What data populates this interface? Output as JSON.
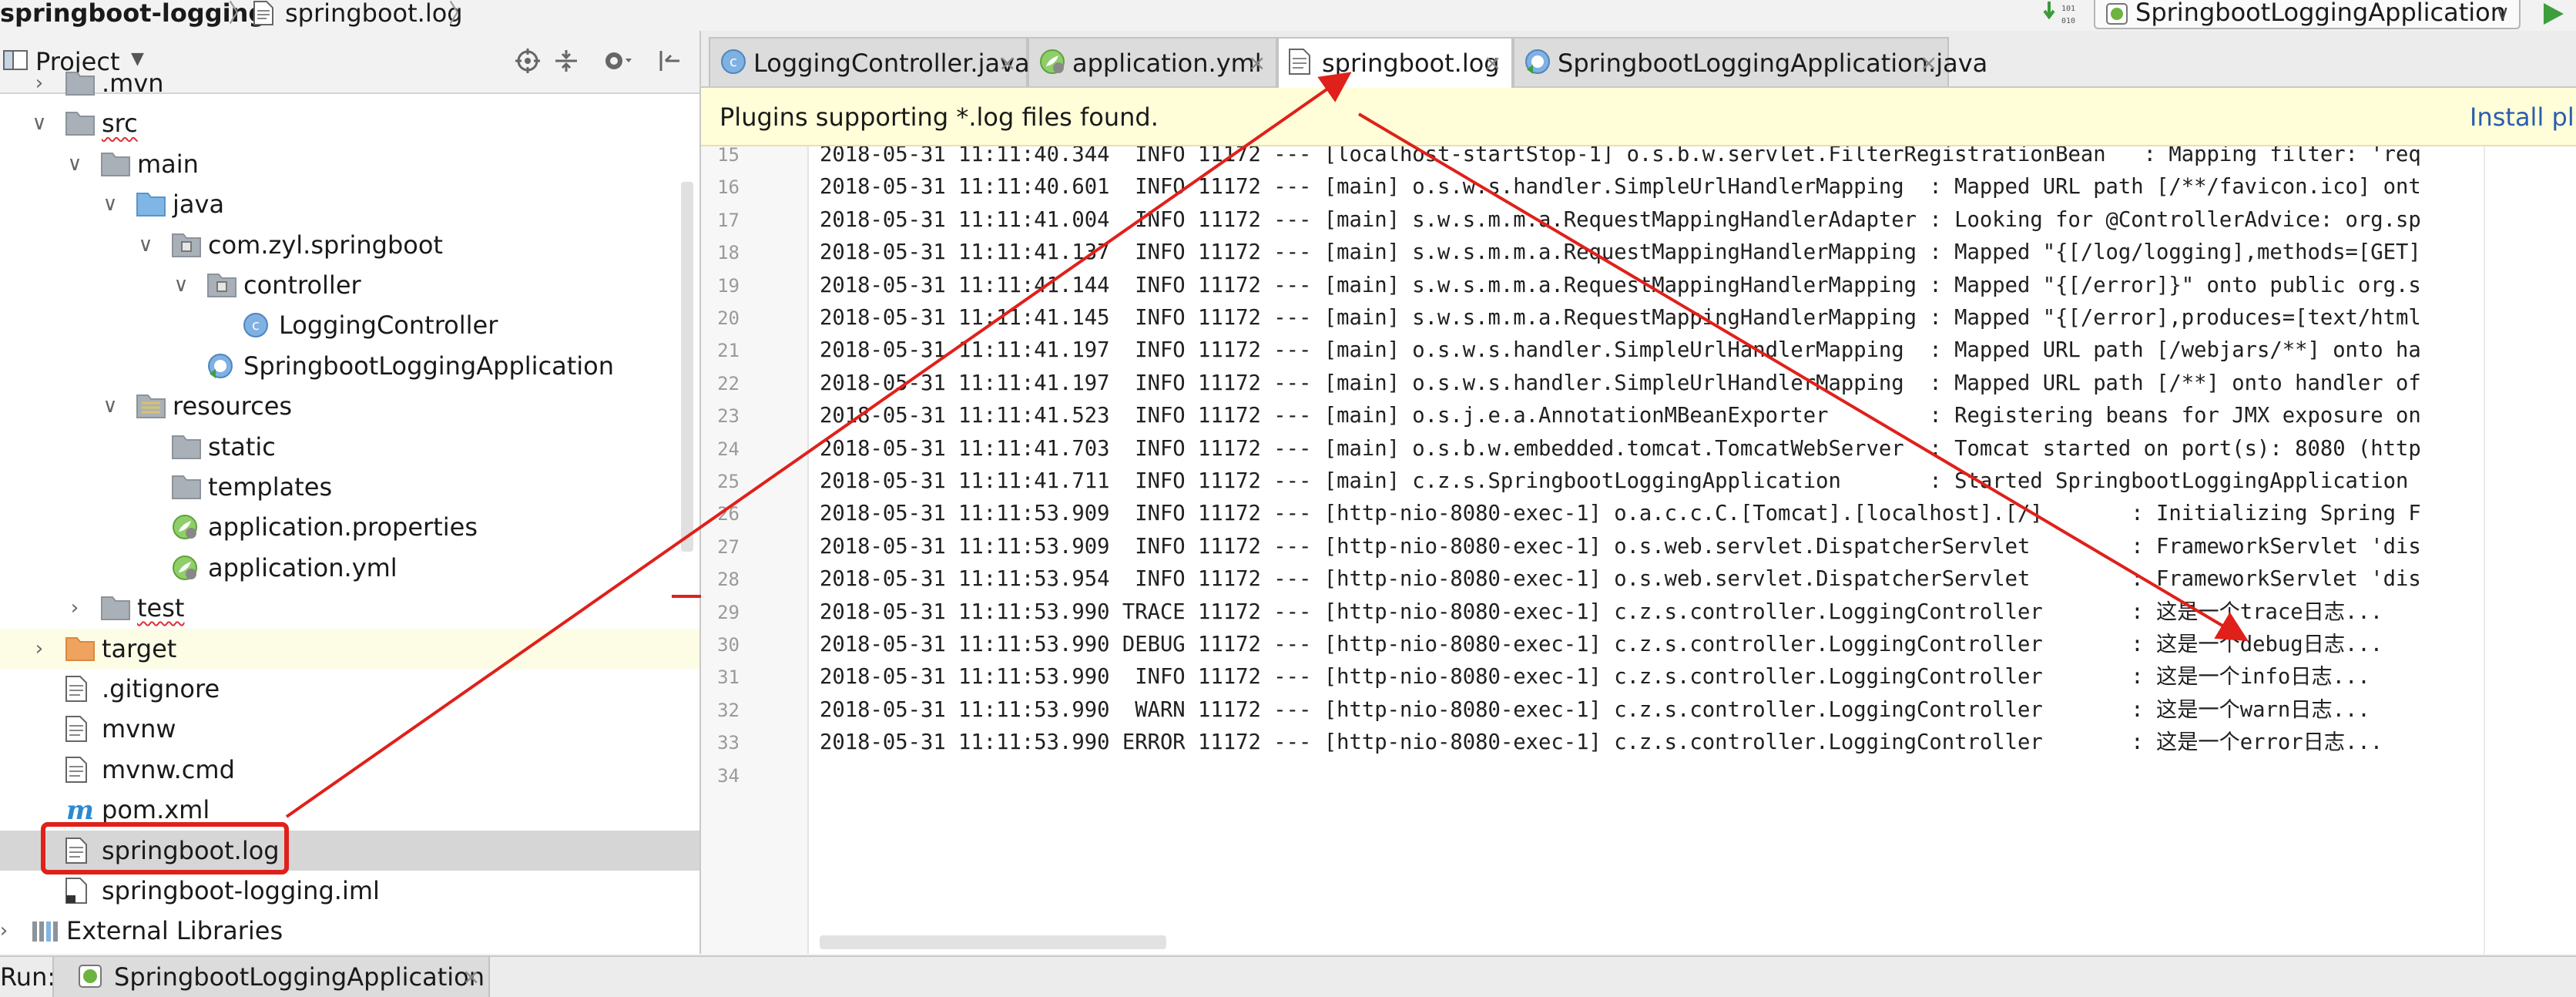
{
  "navbar": {
    "project": "springboot-logging",
    "separator": "〉",
    "file": "springboot.log",
    "run_config": "SpringbootLoggingApplication"
  },
  "project_panel": {
    "title": "Project",
    "items": [
      {
        "label": ".mvn",
        "depth": 1,
        "icon": "folder-icon",
        "arrow": "right"
      },
      {
        "label": "src",
        "depth": 1,
        "icon": "folder-icon",
        "arrow": "down",
        "squiggle": true
      },
      {
        "label": "main",
        "depth": 2,
        "icon": "folder-icon",
        "arrow": "down"
      },
      {
        "label": "java",
        "depth": 3,
        "icon": "source-folder-icon",
        "arrow": "down"
      },
      {
        "label": "com.zyl.springboot",
        "depth": 4,
        "icon": "package-icon",
        "arrow": "down"
      },
      {
        "label": "controller",
        "depth": 5,
        "icon": "package-icon",
        "arrow": "down"
      },
      {
        "label": "LoggingController",
        "depth": 6,
        "icon": "java-class-icon"
      },
      {
        "label": "SpringbootLoggingApplication",
        "depth": 5,
        "icon": "spring-boot-class-icon"
      },
      {
        "label": "resources",
        "depth": 3,
        "icon": "resources-folder-icon",
        "arrow": "down"
      },
      {
        "label": "static",
        "depth": 4,
        "icon": "folder-icon"
      },
      {
        "label": "templates",
        "depth": 4,
        "icon": "folder-icon"
      },
      {
        "label": "application.properties",
        "depth": 4,
        "icon": "spring-config-icon"
      },
      {
        "label": "application.yml",
        "depth": 4,
        "icon": "spring-config-icon"
      },
      {
        "label": "test",
        "depth": 2,
        "icon": "folder-icon",
        "arrow": "right",
        "squiggle": true
      },
      {
        "label": "target",
        "depth": 1,
        "icon": "excluded-folder-icon",
        "arrow": "right",
        "highlight": "yellow"
      },
      {
        "label": ".gitignore",
        "depth": 1,
        "icon": "text-file-icon"
      },
      {
        "label": "mvnw",
        "depth": 1,
        "icon": "text-file-icon"
      },
      {
        "label": "mvnw.cmd",
        "depth": 1,
        "icon": "text-file-icon"
      },
      {
        "label": "pom.xml",
        "depth": 1,
        "icon": "maven-icon"
      },
      {
        "label": "springboot.log",
        "depth": 1,
        "icon": "text-file-icon",
        "highlight": "selected",
        "boxed": true
      },
      {
        "label": "springboot-logging.iml",
        "depth": 1,
        "icon": "iml-file-icon"
      },
      {
        "label": "External Libraries",
        "depth": 0,
        "icon": "libraries-icon",
        "arrow": "right"
      }
    ]
  },
  "tabs": [
    {
      "label": "LoggingController.java",
      "icon": "java-class-icon",
      "active": false
    },
    {
      "label": "application.yml",
      "icon": "spring-config-icon",
      "active": false
    },
    {
      "label": "springboot.log",
      "icon": "text-file-icon",
      "active": true
    },
    {
      "label": "SpringbootLoggingApplication.java",
      "icon": "spring-boot-class-icon",
      "active": false
    }
  ],
  "notification": {
    "text": "Plugins supporting *.log files found.",
    "link": "Install plu"
  },
  "editor": {
    "lines": [
      {
        "no": "15",
        "text": "2018-05-31 11:11:40.344  INFO 11172 --- [localhost-startStop-1] o.s.b.w.servlet.FilterRegistrationBean   : Mapping filter: 'req"
      },
      {
        "no": "16",
        "text": "2018-05-31 11:11:40.601  INFO 11172 --- [main] o.s.w.s.handler.SimpleUrlHandlerMapping  : Mapped URL path [/**/favicon.ico] ont"
      },
      {
        "no": "17",
        "text": "2018-05-31 11:11:41.004  INFO 11172 --- [main] s.w.s.m.m.a.RequestMappingHandlerAdapter : Looking for @ControllerAdvice: org.sp"
      },
      {
        "no": "18",
        "text": "2018-05-31 11:11:41.137  INFO 11172 --- [main] s.w.s.m.m.a.RequestMappingHandlerMapping : Mapped \"{[/log/logging],methods=[GET]"
      },
      {
        "no": "19",
        "text": "2018-05-31 11:11:41.144  INFO 11172 --- [main] s.w.s.m.m.a.RequestMappingHandlerMapping : Mapped \"{[/error]}\" onto public org.s"
      },
      {
        "no": "20",
        "text": "2018-05-31 11:11:41.145  INFO 11172 --- [main] s.w.s.m.m.a.RequestMappingHandlerMapping : Mapped \"{[/error],produces=[text/html"
      },
      {
        "no": "21",
        "text": "2018-05-31 11:11:41.197  INFO 11172 --- [main] o.s.w.s.handler.SimpleUrlHandlerMapping  : Mapped URL path [/webjars/**] onto ha"
      },
      {
        "no": "22",
        "text": "2018-05-31 11:11:41.197  INFO 11172 --- [main] o.s.w.s.handler.SimpleUrlHandlerMapping  : Mapped URL path [/**] onto handler of"
      },
      {
        "no": "23",
        "text": "2018-05-31 11:11:41.523  INFO 11172 --- [main] o.s.j.e.a.AnnotationMBeanExporter        : Registering beans for JMX exposure on"
      },
      {
        "no": "24",
        "text": "2018-05-31 11:11:41.703  INFO 11172 --- [main] o.s.b.w.embedded.tomcat.TomcatWebServer  : Tomcat started on port(s): 8080 (http"
      },
      {
        "no": "25",
        "text": "2018-05-31 11:11:41.711  INFO 11172 --- [main] c.z.s.SpringbootLoggingApplication       : Started SpringbootLoggingApplication "
      },
      {
        "no": "26",
        "text": "2018-05-31 11:11:53.909  INFO 11172 --- [http-nio-8080-exec-1] o.a.c.c.C.[Tomcat].[localhost].[/]       : Initializing Spring F"
      },
      {
        "no": "27",
        "text": "2018-05-31 11:11:53.909  INFO 11172 --- [http-nio-8080-exec-1] o.s.web.servlet.DispatcherServlet        : FrameworkServlet 'dis"
      },
      {
        "no": "28",
        "text": "2018-05-31 11:11:53.954  INFO 11172 --- [http-nio-8080-exec-1] o.s.web.servlet.DispatcherServlet        : FrameworkServlet 'dis"
      },
      {
        "no": "29",
        "text": "2018-05-31 11:11:53.990 TRACE 11172 --- [http-nio-8080-exec-1] c.z.s.controller.LoggingController       : 这是一个trace日志..."
      },
      {
        "no": "30",
        "text": "2018-05-31 11:11:53.990 DEBUG 11172 --- [http-nio-8080-exec-1] c.z.s.controller.LoggingController       : 这是一个debug日志..."
      },
      {
        "no": "31",
        "text": "2018-05-31 11:11:53.990  INFO 11172 --- [http-nio-8080-exec-1] c.z.s.controller.LoggingController       : 这是一个info日志..."
      },
      {
        "no": "32",
        "text": "2018-05-31 11:11:53.990  WARN 11172 --- [http-nio-8080-exec-1] c.z.s.controller.LoggingController       : 这是一个warn日志..."
      },
      {
        "no": "33",
        "text": "2018-05-31 11:11:53.990 ERROR 11172 --- [http-nio-8080-exec-1] c.z.s.controller.LoggingController       : 这是一个error日志..."
      },
      {
        "no": "34",
        "text": ""
      }
    ]
  },
  "run_bar": {
    "label": "Run:",
    "tab": "SpringbootLoggingApplication"
  },
  "colors": {
    "annotation": "#e0201a",
    "link": "#2a5db0",
    "notification_bg": "#fffed8",
    "selected_row": "#d6d6d6"
  }
}
